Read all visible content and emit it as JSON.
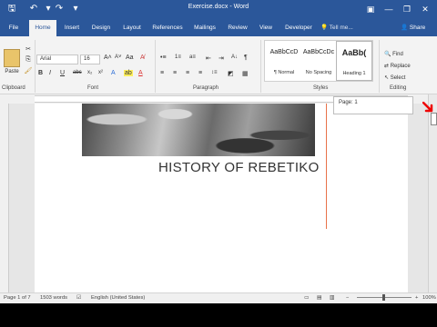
{
  "titlebar": {
    "title": "Exercise.docx - Word",
    "color": "#2b579a"
  },
  "tabs": [
    {
      "label": "File"
    },
    {
      "label": "Home",
      "active": true
    },
    {
      "label": "Insert"
    },
    {
      "label": "Design"
    },
    {
      "label": "Layout"
    },
    {
      "label": "References"
    },
    {
      "label": "Mailings"
    },
    {
      "label": "Review"
    },
    {
      "label": "View"
    },
    {
      "label": "Developer"
    }
  ],
  "tellme": "Tell me...",
  "share": "Share",
  "ribbon": {
    "clipboard": {
      "label": "Clipboard",
      "paste": "Paste"
    },
    "font": {
      "label": "Font",
      "name": "Arial",
      "size": "16"
    },
    "paragraph": {
      "label": "Paragraph"
    },
    "styles": {
      "label": "Styles",
      "items": [
        {
          "sample": "AaBbCcD",
          "name": "¶ Normal"
        },
        {
          "sample": "AaBbCcDc",
          "name": "No Spacing"
        },
        {
          "sample": "AaBb(",
          "name": "Heading 1"
        }
      ]
    },
    "editing": {
      "label": "Editing",
      "find": "Find",
      "replace": "Replace",
      "select": "Select"
    }
  },
  "document": {
    "heading": "HISTORY OF REBETIKO"
  },
  "tooltip": "Page: 1",
  "status": {
    "page": "Page 1 of 7",
    "words": "1503 words",
    "language": "English (United States)",
    "zoom": "100%"
  }
}
